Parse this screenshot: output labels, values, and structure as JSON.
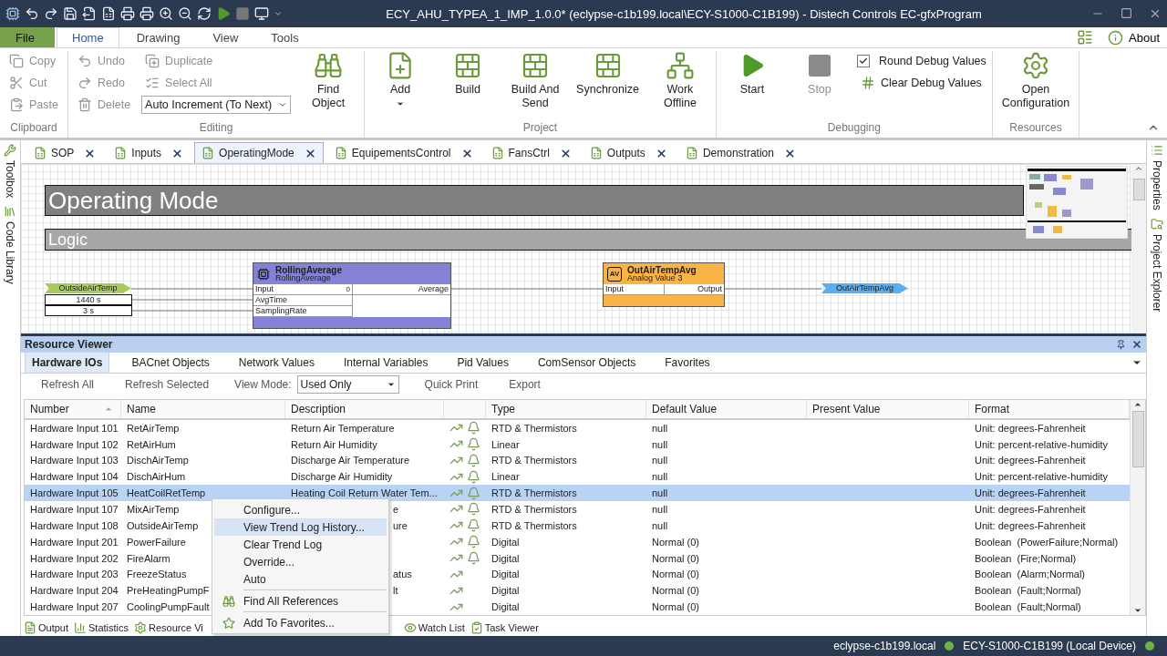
{
  "window": {
    "title": "ECY_AHU_TYPEA_1_IMP_1.0.0* (eclypse-c1b199.local\\ECY-S1000-C1B199) - Distech Controls EC-gfxProgram"
  },
  "ribbon_tabs": [
    {
      "label": "File",
      "kind": "file",
      "selected": false
    },
    {
      "label": "Home",
      "kind": "tab",
      "selected": true
    },
    {
      "label": "Drawing",
      "kind": "tab",
      "selected": false
    },
    {
      "label": "View",
      "kind": "tab",
      "selected": false
    },
    {
      "label": "Tools",
      "kind": "tab",
      "selected": false
    }
  ],
  "about": "About",
  "ribbon_groups": [
    {
      "label": "Clipboard",
      "columns": [
        [
          {
            "kind": "small",
            "label": "Copy",
            "disabled": true
          },
          {
            "kind": "small",
            "label": "Cut",
            "disabled": true
          },
          {
            "kind": "small",
            "label": "Paste",
            "disabled": true
          }
        ]
      ]
    },
    {
      "label": "Editing",
      "columns": [
        [
          {
            "kind": "small",
            "label": "Undo",
            "disabled": true
          },
          {
            "kind": "small",
            "label": "Redo",
            "disabled": true
          },
          {
            "kind": "small",
            "label": "Delete",
            "disabled": true
          }
        ],
        [
          {
            "kind": "small",
            "label": "Duplicate",
            "disabled": true
          },
          {
            "kind": "small",
            "label": "Select All",
            "disabled": true
          },
          {
            "kind": "dropdown",
            "label": "Auto Increment (To Next)"
          }
        ],
        [
          {
            "kind": "large",
            "label": "Find Object",
            "disabled": false
          }
        ]
      ]
    },
    {
      "label": "Project",
      "columns": [
        [
          {
            "kind": "large_menu",
            "label": "Add",
            "disabled": false
          }
        ],
        [
          {
            "kind": "large",
            "label": "Build",
            "disabled": false
          }
        ],
        [
          {
            "kind": "large",
            "label": "Build And Send",
            "disabled": false
          }
        ],
        [
          {
            "kind": "large",
            "label": "Synchronize",
            "disabled": false
          }
        ],
        [
          {
            "kind": "large",
            "label": "Work Offline",
            "disabled": false
          }
        ]
      ]
    },
    {
      "label": "Debugging",
      "columns": [
        [
          {
            "kind": "large",
            "label": "Start",
            "disabled": false
          }
        ],
        [
          {
            "kind": "large",
            "label": "Stop",
            "disabled": true
          }
        ],
        [
          {
            "kind": "check",
            "label": "Round Debug Values",
            "checked": true
          },
          {
            "kind": "small",
            "label": "Clear Debug Values",
            "disabled": false
          }
        ]
      ]
    },
    {
      "label": "Resources",
      "columns": [
        [
          {
            "kind": "large",
            "label": "Open Configuration",
            "disabled": false
          }
        ]
      ]
    }
  ],
  "left_panels": [
    "Toolbox",
    "Code Library"
  ],
  "right_panels": [
    "Properties",
    "Project Explorer"
  ],
  "document_tabs": [
    {
      "label": "SOP",
      "selected": false
    },
    {
      "label": "Inputs",
      "selected": false
    },
    {
      "label": "OperatingMode",
      "selected": true
    },
    {
      "label": "EquipementsControl",
      "selected": false
    },
    {
      "label": "FansCtrl",
      "selected": false
    },
    {
      "label": "Outputs",
      "selected": false
    },
    {
      "label": "Demonstration",
      "selected": false
    }
  ],
  "diagram": {
    "banners": [
      "Operating Mode",
      "Logic"
    ],
    "input_tag": "OutsideAirTemp",
    "constants": [
      "1440 s",
      "3 s"
    ],
    "blocks": [
      {
        "title": "RollingAverage",
        "subtitle": "RollingAverage",
        "color": "#8482d6",
        "inputs": [
          "Input",
          "AvgTime",
          "SamplingRate"
        ],
        "input_value": "0",
        "outputs": [
          "Average"
        ]
      },
      {
        "title": "OutAirTempAvg",
        "subtitle": "Analog Value 3",
        "icon_text": "AV",
        "color": "#f9b347",
        "inputs": [
          "Input"
        ],
        "outputs": [
          "Output"
        ]
      }
    ],
    "output_tag": "OutAirTempAvg"
  },
  "resource_viewer": {
    "title": "Resource Viewer",
    "tabs": [
      {
        "label": "Hardware IOs",
        "selected": true
      },
      {
        "label": "BACnet Objects",
        "selected": false
      },
      {
        "label": "Network Values",
        "selected": false
      },
      {
        "label": "Internal Variables",
        "selected": false
      },
      {
        "label": "Pid Values",
        "selected": false
      },
      {
        "label": "ComSensor Objects",
        "selected": false
      },
      {
        "label": "Favorites",
        "selected": false
      }
    ],
    "toolbar": {
      "refresh_all": "Refresh All",
      "refresh_selected": "Refresh Selected",
      "view_mode_label": "View Mode:",
      "view_mode": "Used Only",
      "quick_print": "Quick Print",
      "export": "Export"
    },
    "columns": [
      {
        "label": "Number",
        "sorted": true
      },
      {
        "label": "Name",
        "sorted": false
      },
      {
        "label": "Description",
        "sorted": false
      },
      {
        "label": "Type",
        "sorted": false
      },
      {
        "label": "Default Value",
        "sorted": false
      },
      {
        "label": "Present Value",
        "sorted": false
      },
      {
        "label": "Format",
        "sorted": false
      }
    ],
    "rows": [
      {
        "number": "Hardware Input 101",
        "name": "RetAirTemp",
        "description": "Return Air Temperature",
        "alarm": true,
        "type": "RTD & Thermistors",
        "default": "null",
        "format": "Unit: degrees-Fahrenheit",
        "selected": false,
        "covered": false
      },
      {
        "number": "Hardware Input 102",
        "name": "RetAirHum",
        "description": "Return Air Humidity",
        "alarm": true,
        "type": "Linear",
        "default": "null",
        "format": "Unit: percent-relative-humidity",
        "selected": false,
        "covered": false
      },
      {
        "number": "Hardware Input 103",
        "name": "DischAirTemp",
        "description": "Discharge Air Temperature",
        "alarm": true,
        "type": "RTD & Thermistors",
        "default": "null",
        "format": "Unit: degrees-Fahrenheit",
        "selected": false,
        "covered": false
      },
      {
        "number": "Hardware Input 104",
        "name": "DischAirHum",
        "description": "Discharge Air Humidity",
        "alarm": true,
        "type": "Linear",
        "default": "null",
        "format": "Unit: percent-relative-humidity",
        "selected": false,
        "covered": false
      },
      {
        "number": "Hardware Input 105",
        "name": "HeatCoilRetTemp",
        "description": "Heating Coil Return Water Tem...",
        "alarm": true,
        "type": "RTD & Thermistors",
        "default": "null",
        "format": "Unit: degrees-Fahrenheit",
        "selected": true,
        "covered": false
      },
      {
        "number": "Hardware Input 107",
        "name": "MixAirTemp",
        "description": "e",
        "alarm": true,
        "type": "RTD & Thermistors",
        "default": "null",
        "format": "Unit: degrees-Fahrenheit",
        "selected": false,
        "covered": true
      },
      {
        "number": "Hardware Input 108",
        "name": "OutsideAirTemp",
        "description": "ure",
        "alarm": true,
        "type": "RTD & Thermistors",
        "default": "null",
        "format": "Unit: degrees-Fahrenheit",
        "selected": false,
        "covered": true
      },
      {
        "number": "Hardware Input 201",
        "name": "PowerFailure",
        "alarm": true,
        "type": "Digital",
        "default": "Normal (0)",
        "format": "Boolean  (PowerFailure;Normal)",
        "selected": false
      },
      {
        "number": "Hardware Input 202",
        "name": "FireAlarm",
        "alarm": true,
        "type": "Digital",
        "default": "Normal (0)",
        "format": "Boolean  (Fire;Normal)",
        "selected": false
      },
      {
        "number": "Hardware Input 203",
        "name": "FreezeStatus",
        "description": "atus",
        "alarm": false,
        "type": "Digital",
        "default": "Normal (0)",
        "format": "Boolean  (Alarm;Normal)",
        "selected": false,
        "covered": true
      },
      {
        "number": "Hardware Input 204",
        "name": "PreHeatingPumpF",
        "description": "lt",
        "alarm": false,
        "type": "Digital",
        "default": "Normal (0)",
        "format": "Boolean  (Fault;Normal)",
        "selected": false,
        "covered": true
      },
      {
        "number": "Hardware Input 207",
        "name": "CoolingPumpFault",
        "alarm": false,
        "type": "Digital",
        "default": "Normal (0)",
        "format": "Boolean  (Fault;Normal)",
        "selected": false
      }
    ]
  },
  "context_menu": [
    {
      "kind": "item",
      "label": "Configure...",
      "selected": false
    },
    {
      "kind": "item",
      "label": "View Trend Log History...",
      "selected": true
    },
    {
      "kind": "item",
      "label": "Clear Trend Log",
      "selected": false
    },
    {
      "kind": "item",
      "label": "Override...",
      "selected": false
    },
    {
      "kind": "item",
      "label": "Auto",
      "selected": false
    },
    {
      "kind": "separator"
    },
    {
      "kind": "item",
      "label": "Find All References",
      "selected": false
    },
    {
      "kind": "separator"
    },
    {
      "kind": "item",
      "label": "Add To Favorites...",
      "selected": false
    }
  ],
  "bottom_tabs": [
    "Output",
    "Statistics",
    "Resource Vi",
    "Watch List",
    "Task Viewer"
  ],
  "status_bar": [
    {
      "label": "eclypse-c1b199.local",
      "color": "#6cb33f"
    },
    {
      "label": "ECY-S1000-C1B199 (Local Device)",
      "color": "#6cb33f"
    }
  ]
}
